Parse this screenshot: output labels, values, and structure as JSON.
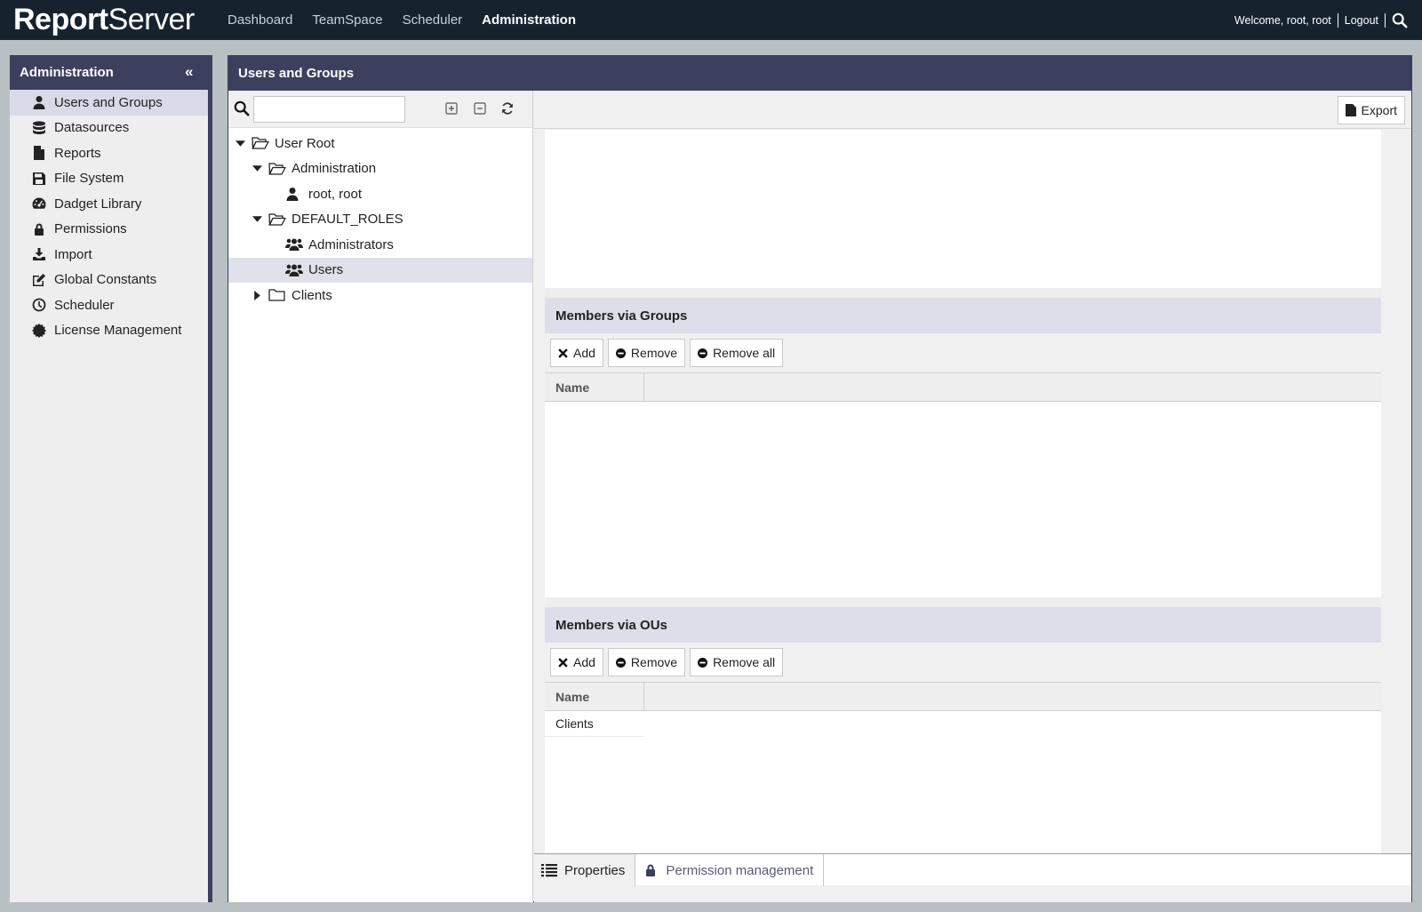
{
  "topbar": {
    "logo_bold": "Report",
    "logo_light": "Server",
    "nav": [
      {
        "label": "Dashboard",
        "active": false
      },
      {
        "label": "TeamSpace",
        "active": false
      },
      {
        "label": "Scheduler",
        "active": false
      },
      {
        "label": "Administration",
        "active": true
      }
    ],
    "welcome": "Welcome, root, root",
    "logout": "Logout",
    "search_icon": "search-icon"
  },
  "sidebar": {
    "title": "Administration",
    "collapse_icon": "double-chevron-left-icon",
    "items": [
      {
        "label": "Users and Groups",
        "icon": "user-icon",
        "active": true
      },
      {
        "label": "Datasources",
        "icon": "database-icon",
        "active": false
      },
      {
        "label": "Reports",
        "icon": "file-icon",
        "active": false
      },
      {
        "label": "File System",
        "icon": "floppy-icon",
        "active": false
      },
      {
        "label": "Dadget Library",
        "icon": "dashboard-icon",
        "active": false
      },
      {
        "label": "Permissions",
        "icon": "lock-icon",
        "active": false
      },
      {
        "label": "Import",
        "icon": "download-icon",
        "active": false
      },
      {
        "label": "Global Constants",
        "icon": "edit-icon",
        "active": false
      },
      {
        "label": "Scheduler",
        "icon": "clock-icon",
        "active": false
      },
      {
        "label": "License Management",
        "icon": "certificate-icon",
        "active": false
      }
    ]
  },
  "main": {
    "title": "Users and Groups",
    "tree": {
      "search_value": "",
      "nodes": [
        {
          "label": "User Root",
          "depth": 0,
          "toggle": "expanded",
          "icon": "folder-open-icon",
          "selected": false
        },
        {
          "label": "Administration",
          "depth": 1,
          "toggle": "expanded",
          "icon": "folder-open-icon",
          "selected": false
        },
        {
          "label": "root, root",
          "depth": 2,
          "toggle": "none",
          "icon": "user-icon",
          "selected": false
        },
        {
          "label": "DEFAULT_ROLES",
          "depth": 1,
          "toggle": "expanded",
          "icon": "folder-open-icon",
          "selected": false
        },
        {
          "label": "Administrators",
          "depth": 2,
          "toggle": "none",
          "icon": "users-icon",
          "selected": false
        },
        {
          "label": "Users",
          "depth": 2,
          "toggle": "none",
          "icon": "users-icon",
          "selected": true
        },
        {
          "label": "Clients",
          "depth": 1,
          "toggle": "collapsed",
          "icon": "folder-icon",
          "selected": false
        }
      ]
    },
    "toolbar": {
      "export_label": "Export"
    },
    "groups_section": {
      "title": "Members via Groups",
      "add": "Add",
      "remove": "Remove",
      "remove_all": "Remove all",
      "column": "Name",
      "rows": []
    },
    "ous_section": {
      "title": "Members via OUs",
      "add": "Add",
      "remove": "Remove",
      "remove_all": "Remove all",
      "column": "Name",
      "rows": [
        "Clients"
      ]
    },
    "tabs": [
      {
        "label": "Properties",
        "icon": "list-icon",
        "active": true
      },
      {
        "label": "Permission management",
        "icon": "lock-icon",
        "active": false
      }
    ]
  },
  "colors": {
    "topbar": "#16232f",
    "panel_header": "#3c3f5e",
    "section_header": "#dedeea",
    "selected_row": "#e0e0ea"
  }
}
